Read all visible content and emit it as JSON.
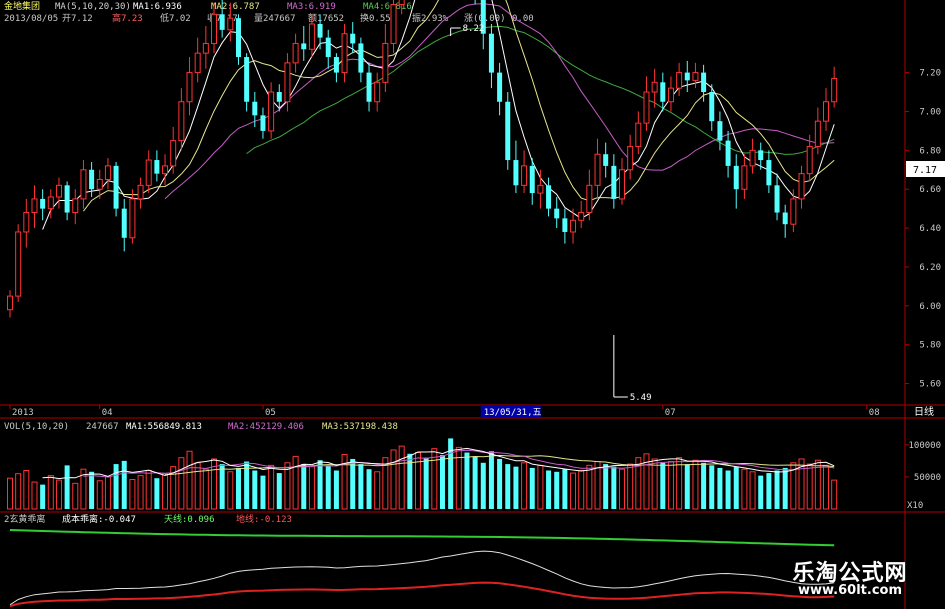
{
  "chart_data": {
    "type": "candlestick",
    "header": {
      "stock_name": "金地集团",
      "ma_label": "MA(5,10,20,30)",
      "ma1_label": "MA1:6.936",
      "ma2_label": "MA2:6.787",
      "ma3_label": "MA3:6.919",
      "ma4_label": "MA4:6.816",
      "date": "2013/08/05",
      "open": "开7.12",
      "high": "高7.23",
      "low": "低7.02",
      "close": "收7.17",
      "volume": "量247667",
      "amount": "额17652",
      "turnover": "换0.55%",
      "amplitude": "振2.93%",
      "change": "涨(0.00)",
      "change2": "0.00"
    },
    "price_axis": {
      "min": 5.5,
      "max": 7.45,
      "ticks": [
        "7.20",
        "7.00",
        "6.80",
        "6.60",
        "6.40",
        "6.20",
        "6.00",
        "5.80",
        "5.60"
      ],
      "current_label": "7.17"
    },
    "date_axis": {
      "labels": [
        {
          "text": "2013",
          "index": 0
        },
        {
          "text": "04",
          "index": 11
        },
        {
          "text": "05",
          "index": 31
        },
        {
          "text": "07",
          "index": 80
        },
        {
          "text": "08",
          "index": 105
        }
      ],
      "highlight": "13/05/31,五",
      "highlight_index": 61,
      "period_label": "日线"
    },
    "annotations": [
      {
        "text": "8.22",
        "index": 54,
        "value": 8.22
      },
      {
        "text": "5.49",
        "index": 74,
        "value": 5.49
      }
    ],
    "candles": [
      [
        5.98,
        6.05,
        5.94,
        6.08
      ],
      [
        6.05,
        6.38,
        6.02,
        6.42
      ],
      [
        6.38,
        6.48,
        6.3,
        6.55
      ],
      [
        6.48,
        6.55,
        6.4,
        6.62
      ],
      [
        6.55,
        6.5,
        6.44,
        6.6
      ],
      [
        6.5,
        6.56,
        6.45,
        6.6
      ],
      [
        6.56,
        6.62,
        6.5,
        6.66
      ],
      [
        6.62,
        6.48,
        6.44,
        6.64
      ],
      [
        6.48,
        6.55,
        6.42,
        6.6
      ],
      [
        6.55,
        6.7,
        6.5,
        6.75
      ],
      [
        6.7,
        6.6,
        6.56,
        6.74
      ],
      [
        6.6,
        6.65,
        6.55,
        6.7
      ],
      [
        6.65,
        6.72,
        6.6,
        6.76
      ],
      [
        6.72,
        6.5,
        6.46,
        6.74
      ],
      [
        6.5,
        6.35,
        6.28,
        6.55
      ],
      [
        6.35,
        6.55,
        6.32,
        6.6
      ],
      [
        6.55,
        6.62,
        6.5,
        6.66
      ],
      [
        6.62,
        6.75,
        6.58,
        6.8
      ],
      [
        6.75,
        6.68,
        6.64,
        6.8
      ],
      [
        6.68,
        6.72,
        6.62,
        6.78
      ],
      [
        6.72,
        6.85,
        6.68,
        6.92
      ],
      [
        6.85,
        7.05,
        6.8,
        7.12
      ],
      [
        7.05,
        7.2,
        6.98,
        7.28
      ],
      [
        7.2,
        7.3,
        7.15,
        7.38
      ],
      [
        7.3,
        7.35,
        7.22,
        7.44
      ],
      [
        7.35,
        7.5,
        7.3,
        7.56
      ],
      [
        7.5,
        7.42,
        7.38,
        7.58
      ],
      [
        7.42,
        7.48,
        7.36,
        7.56
      ],
      [
        7.48,
        7.28,
        7.24,
        7.5
      ],
      [
        7.28,
        7.05,
        7.0,
        7.3
      ],
      [
        7.05,
        6.98,
        6.92,
        7.1
      ],
      [
        6.98,
        6.9,
        6.86,
        7.02
      ],
      [
        6.9,
        7.1,
        6.86,
        7.15
      ],
      [
        7.1,
        7.05,
        7.0,
        7.14
      ],
      [
        7.05,
        7.25,
        7.0,
        7.3
      ],
      [
        7.25,
        7.35,
        7.2,
        7.4
      ],
      [
        7.35,
        7.32,
        7.26,
        7.44
      ],
      [
        7.32,
        7.45,
        7.28,
        7.5
      ],
      [
        7.45,
        7.38,
        7.32,
        7.5
      ],
      [
        7.38,
        7.28,
        7.22,
        7.42
      ],
      [
        7.28,
        7.2,
        7.15,
        7.3
      ],
      [
        7.2,
        7.4,
        7.15,
        7.45
      ],
      [
        7.4,
        7.35,
        7.3,
        7.46
      ],
      [
        7.35,
        7.2,
        7.15,
        7.38
      ],
      [
        7.2,
        7.05,
        7.0,
        7.25
      ],
      [
        7.05,
        7.15,
        7.0,
        7.2
      ],
      [
        7.15,
        7.35,
        7.1,
        7.45
      ],
      [
        7.35,
        7.55,
        7.3,
        7.62
      ],
      [
        7.55,
        7.72,
        7.5,
        7.8
      ],
      [
        7.72,
        7.65,
        7.6,
        7.8
      ],
      [
        7.65,
        7.9,
        7.6,
        7.98
      ],
      [
        7.9,
        7.8,
        7.72,
        7.98
      ],
      [
        7.8,
        7.98,
        7.75,
        8.05
      ],
      [
        7.98,
        7.95,
        7.88,
        8.1
      ],
      [
        7.95,
        7.82,
        7.78,
        8.22
      ],
      [
        7.82,
        7.98,
        7.78,
        8.1
      ],
      [
        7.98,
        7.75,
        7.7,
        8.02
      ],
      [
        7.75,
        7.6,
        7.55,
        7.82
      ],
      [
        7.6,
        7.4,
        7.32,
        7.65
      ],
      [
        7.4,
        7.2,
        7.12,
        7.45
      ],
      [
        7.2,
        7.05,
        6.98,
        7.25
      ],
      [
        7.05,
        6.75,
        6.7,
        7.1
      ],
      [
        6.75,
        6.62,
        6.58,
        6.85
      ],
      [
        6.62,
        6.72,
        6.58,
        6.8
      ],
      [
        6.72,
        6.58,
        6.52,
        6.76
      ],
      [
        6.58,
        6.62,
        6.5,
        6.7
      ],
      [
        6.62,
        6.5,
        6.46,
        6.66
      ],
      [
        6.5,
        6.45,
        6.4,
        6.56
      ],
      [
        6.45,
        6.38,
        6.32,
        6.5
      ],
      [
        6.38,
        6.44,
        6.32,
        6.5
      ],
      [
        6.44,
        6.48,
        6.4,
        6.54
      ],
      [
        6.48,
        6.62,
        6.44,
        6.7
      ],
      [
        6.62,
        6.78,
        6.55,
        6.86
      ],
      [
        6.78,
        6.72,
        6.66,
        6.84
      ],
      [
        6.72,
        6.55,
        6.5,
        6.78
      ],
      [
        6.55,
        6.7,
        6.52,
        6.76
      ],
      [
        6.7,
        6.82,
        6.65,
        6.88
      ],
      [
        6.82,
        6.94,
        6.78,
        7.0
      ],
      [
        6.94,
        7.1,
        6.9,
        7.18
      ],
      [
        7.1,
        7.15,
        7.02,
        7.22
      ],
      [
        7.15,
        7.05,
        7.0,
        7.2
      ],
      [
        7.05,
        7.12,
        7.0,
        7.18
      ],
      [
        7.12,
        7.2,
        7.08,
        7.25
      ],
      [
        7.2,
        7.16,
        7.1,
        7.26
      ],
      [
        7.16,
        7.2,
        7.12,
        7.25
      ],
      [
        7.2,
        7.1,
        7.05,
        7.24
      ],
      [
        7.1,
        6.95,
        6.9,
        7.14
      ],
      [
        6.95,
        6.85,
        6.8,
        7.0
      ],
      [
        6.85,
        6.72,
        6.66,
        6.9
      ],
      [
        6.72,
        6.6,
        6.5,
        6.78
      ],
      [
        6.6,
        6.72,
        6.55,
        6.78
      ],
      [
        6.72,
        6.8,
        6.68,
        6.86
      ],
      [
        6.8,
        6.75,
        6.7,
        6.84
      ],
      [
        6.75,
        6.62,
        6.58,
        6.8
      ],
      [
        6.62,
        6.48,
        6.44,
        6.68
      ],
      [
        6.48,
        6.42,
        6.35,
        6.52
      ],
      [
        6.42,
        6.55,
        6.38,
        6.6
      ],
      [
        6.55,
        6.68,
        6.5,
        6.72
      ],
      [
        6.68,
        6.82,
        6.64,
        6.88
      ],
      [
        6.82,
        6.95,
        6.78,
        7.02
      ],
      [
        6.95,
        7.05,
        6.9,
        7.12
      ],
      [
        7.05,
        7.17,
        7.02,
        7.23
      ]
    ],
    "volume": {
      "label": "VOL(5,10,20)",
      "vol_value": "247667",
      "ma1_label": "MA1:556849.813",
      "ma2_label": "MA2:452129.406",
      "ma3_label": "MA3:537198.438",
      "ticks": [
        "100000",
        "50000"
      ],
      "unit_label": "X10",
      "max": 120000,
      "values": [
        48000,
        55000,
        60000,
        42000,
        38000,
        52000,
        45000,
        68000,
        40000,
        62000,
        58000,
        44000,
        50000,
        70000,
        75000,
        46000,
        52000,
        60000,
        48000,
        55000,
        66000,
        80000,
        90000,
        72000,
        62000,
        78000,
        70000,
        58000,
        64000,
        74000,
        60000,
        52000,
        68000,
        56000,
        72000,
        82000,
        70000,
        66000,
        76000,
        68000,
        60000,
        85000,
        78000,
        70000,
        62000,
        58000,
        80000,
        92000,
        98000,
        86000,
        88000,
        80000,
        94000,
        84000,
        110000,
        96000,
        88000,
        82000,
        72000,
        90000,
        78000,
        70000,
        66000,
        72000,
        64000,
        68000,
        60000,
        58000,
        62000,
        56000,
        60000,
        68000,
        74000,
        70000,
        66000,
        62000,
        70000,
        80000,
        86000,
        78000,
        72000,
        74000,
        80000,
        70000,
        76000,
        72000,
        68000,
        64000,
        60000,
        66000,
        62000,
        58000,
        52000,
        56000,
        60000,
        64000,
        72000,
        78000,
        70000,
        76000,
        68000,
        45000
      ]
    },
    "indicator": {
      "label": "2玄黄乖离",
      "cost_label": "成本乖离:-0.047",
      "sky_label": "天线:0.096",
      "earth_label": "地线:-0.123"
    },
    "watermark": {
      "title": "乐淘公式网",
      "url": "www.60lt.com"
    },
    "colors": {
      "up": "#ff3333",
      "down": "#54ffff",
      "ma1": "#ffffff",
      "ma2": "#e6e68c",
      "ma3": "#c65cc6",
      "ma4": "#3faa3f",
      "axis": "#b00000",
      "label": "#c8c8c8"
    }
  }
}
